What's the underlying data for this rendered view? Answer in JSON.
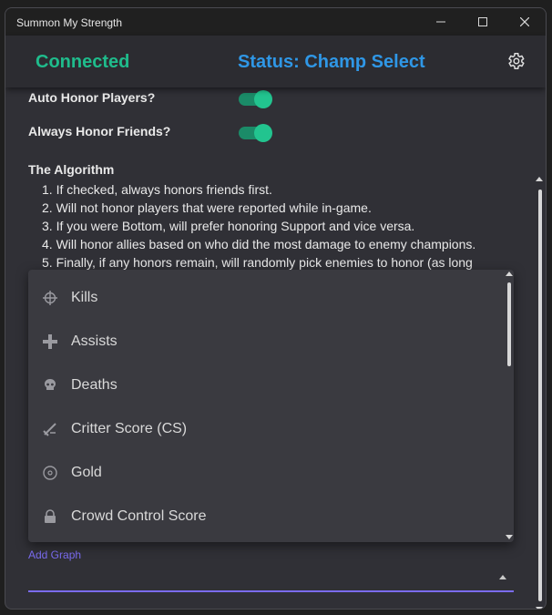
{
  "window": {
    "title": "Summon My Strength"
  },
  "appbar": {
    "connection": "Connected",
    "status": "Status: Champ Select"
  },
  "options": [
    {
      "label": "Auto Honor Players?",
      "enabled": true
    },
    {
      "label": "Always Honor Friends?",
      "enabled": true
    }
  ],
  "algorithm": {
    "title": "The Algorithm",
    "steps": [
      "1. If checked, always honors friends first.",
      "2. Will not honor players that were reported while in-game.",
      "3. If you were Bottom, will prefer honoring Support and vice versa.",
      "4. Will honor allies based on who did the most damage to enemy champions.",
      "5. Finally, if any honors remain, will randomly pick enemies to honor (as long"
    ]
  },
  "dropdown": {
    "items": [
      {
        "label": "Kills",
        "icon": "crosshair-icon"
      },
      {
        "label": "Assists",
        "icon": "plus-icon"
      },
      {
        "label": "Deaths",
        "icon": "skull-icon"
      },
      {
        "label": "Critter Score (CS)",
        "icon": "sword-icon"
      },
      {
        "label": "Gold",
        "icon": "coin-icon"
      },
      {
        "label": "Crowd Control Score",
        "icon": "lock-icon"
      }
    ]
  },
  "add_graph": {
    "label": "Add Graph",
    "value": ""
  },
  "colors": {
    "connected": "#1fbc8c",
    "status": "#2f97e6",
    "accent": "#7b6cf2",
    "toggle_on": "#22c48f"
  }
}
